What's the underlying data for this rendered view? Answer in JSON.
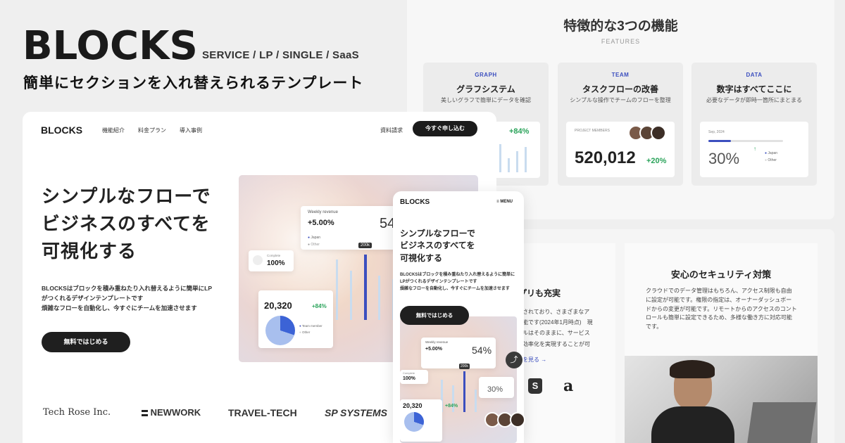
{
  "brand": {
    "name": "BLOCKS",
    "tags": "SERVICE / LP / SINGLE / SaaS",
    "tagline": "簡単にセクションを入れ替えられるテンプレート"
  },
  "features": {
    "title": "特徴的な3つの機能",
    "subtitle": "FEATURES",
    "cards": [
      {
        "tag": "GRAPH",
        "title": "グラフシステム",
        "desc": "美しいグラフで簡単にデータを確認",
        "value": "+84%"
      },
      {
        "tag": "TEAM",
        "title": "タスクフローの改善",
        "desc": "シンプルな操作でチームのフローを整理",
        "label": "PROJECT MEMBERS",
        "value": "520,012",
        "delta": "+20%"
      },
      {
        "tag": "DATA",
        "title": "数字はすべてここに",
        "desc": "必要なデータが即時一箇所にまとまる",
        "label": "Sep, 2024",
        "value": "30%",
        "legend": [
          "Japan",
          "Other"
        ],
        "progress": 0.3
      }
    ]
  },
  "bottom": {
    "left_heading_fragment": "プリも充実",
    "left_body": [
      "されており、さまざまなア",
      "能です(2024年1月時点)　現",
      "ルはそのままに、サービス",
      "効率化を実現することが可"
    ],
    "left_link": "を見る →",
    "security": {
      "title": "安心のセキュリティ対策",
      "body": "クラウドでのデータ管理はもちろん、アクセス制限も自由に設定が可能です。権限の指定は、オーナーダッシュボードからの変更が可能です。リモートからのアクセスのコントロールも簡単に設定できるため、多様な働き方に対応可能です。"
    }
  },
  "lp": {
    "logo": "BLOCKS",
    "nav": [
      "機能紹介",
      "料金プラン",
      "導入事例"
    ],
    "doc": "資料請求",
    "cta": "今すぐ申し込む",
    "hero_title": [
      "シンプルなフローで",
      "ビジネスのすべてを",
      "可視化する"
    ],
    "hero_body": [
      "BLOCKSはブロックを積み重ねたり入れ替えるように簡単にLP",
      "がつくれるデザインテンプレートです",
      "煩雑なフローを自動化し、今すぐにチームを加速させます"
    ],
    "hero_button": "無料ではじめる",
    "logos": [
      "Tech Rose Inc.",
      "NEWWORK",
      "TRAVEL-TECH",
      "SP SYSTEMS"
    ],
    "widgets": {
      "weekly_label": "Weekly revenue",
      "weekly_value": "+5.00%",
      "weekly_big": "54",
      "legend": [
        "Japan",
        "Other"
      ],
      "complete_label": "Complete",
      "complete_value": "100%",
      "bubble": "200k",
      "total_value": "20,320",
      "total_delta": "+84%",
      "team_legend": [
        "Team member",
        "Other"
      ]
    }
  },
  "mobile": {
    "logo": "BLOCKS",
    "menu": "≡ MENU",
    "title": [
      "シンプルなフローで",
      "ビジネスのすべてを",
      "可視化する"
    ],
    "body": [
      "BLOCKSはブロックを積み重ねたり入れ替えるように簡単に",
      "LPがつくれるデザインテンプレートです",
      "煩雑なフローを自動化し、今すぐにチームを加速させます"
    ],
    "button": "無料ではじめる",
    "widgets": {
      "weekly_label": "Weekly revenue",
      "weekly_value": "+5.00%",
      "weekly_big": "54%",
      "complete_label": "Complete",
      "complete_value": "100%",
      "bubble": "200k",
      "small_value": "30%",
      "total_value": "20,320",
      "total_delta": "+84%"
    }
  },
  "colors": {
    "accent": "#3c4fbf",
    "green": "#2aa35a",
    "dark": "#1b1b1b"
  }
}
